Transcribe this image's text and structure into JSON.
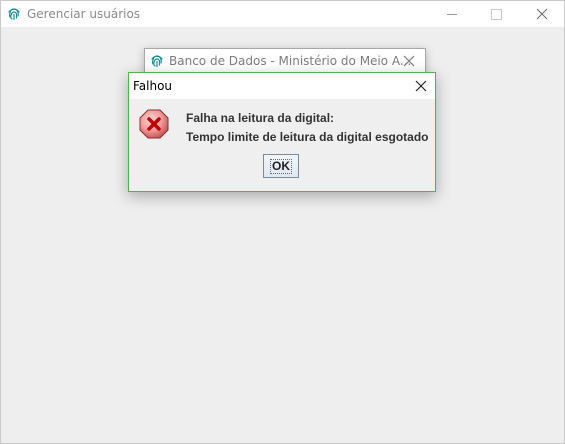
{
  "main_window": {
    "title": "Gerenciar usuários",
    "icon": "fingerprint-icon"
  },
  "db_window": {
    "title": "Banco de Dados - Ministério do Meio A...",
    "icon": "fingerprint-icon"
  },
  "dialog": {
    "title": "Falhou",
    "icon": "error-stop-icon",
    "message_line1": "Falha na leitura da digital:",
    "message_line2": "Tempo limite de leitura da digital esgotado",
    "ok_label": "OK"
  },
  "colors": {
    "accent_border": "#4fb34f",
    "fingerprint": "#1b8a9a",
    "error_red": "#d93030"
  }
}
